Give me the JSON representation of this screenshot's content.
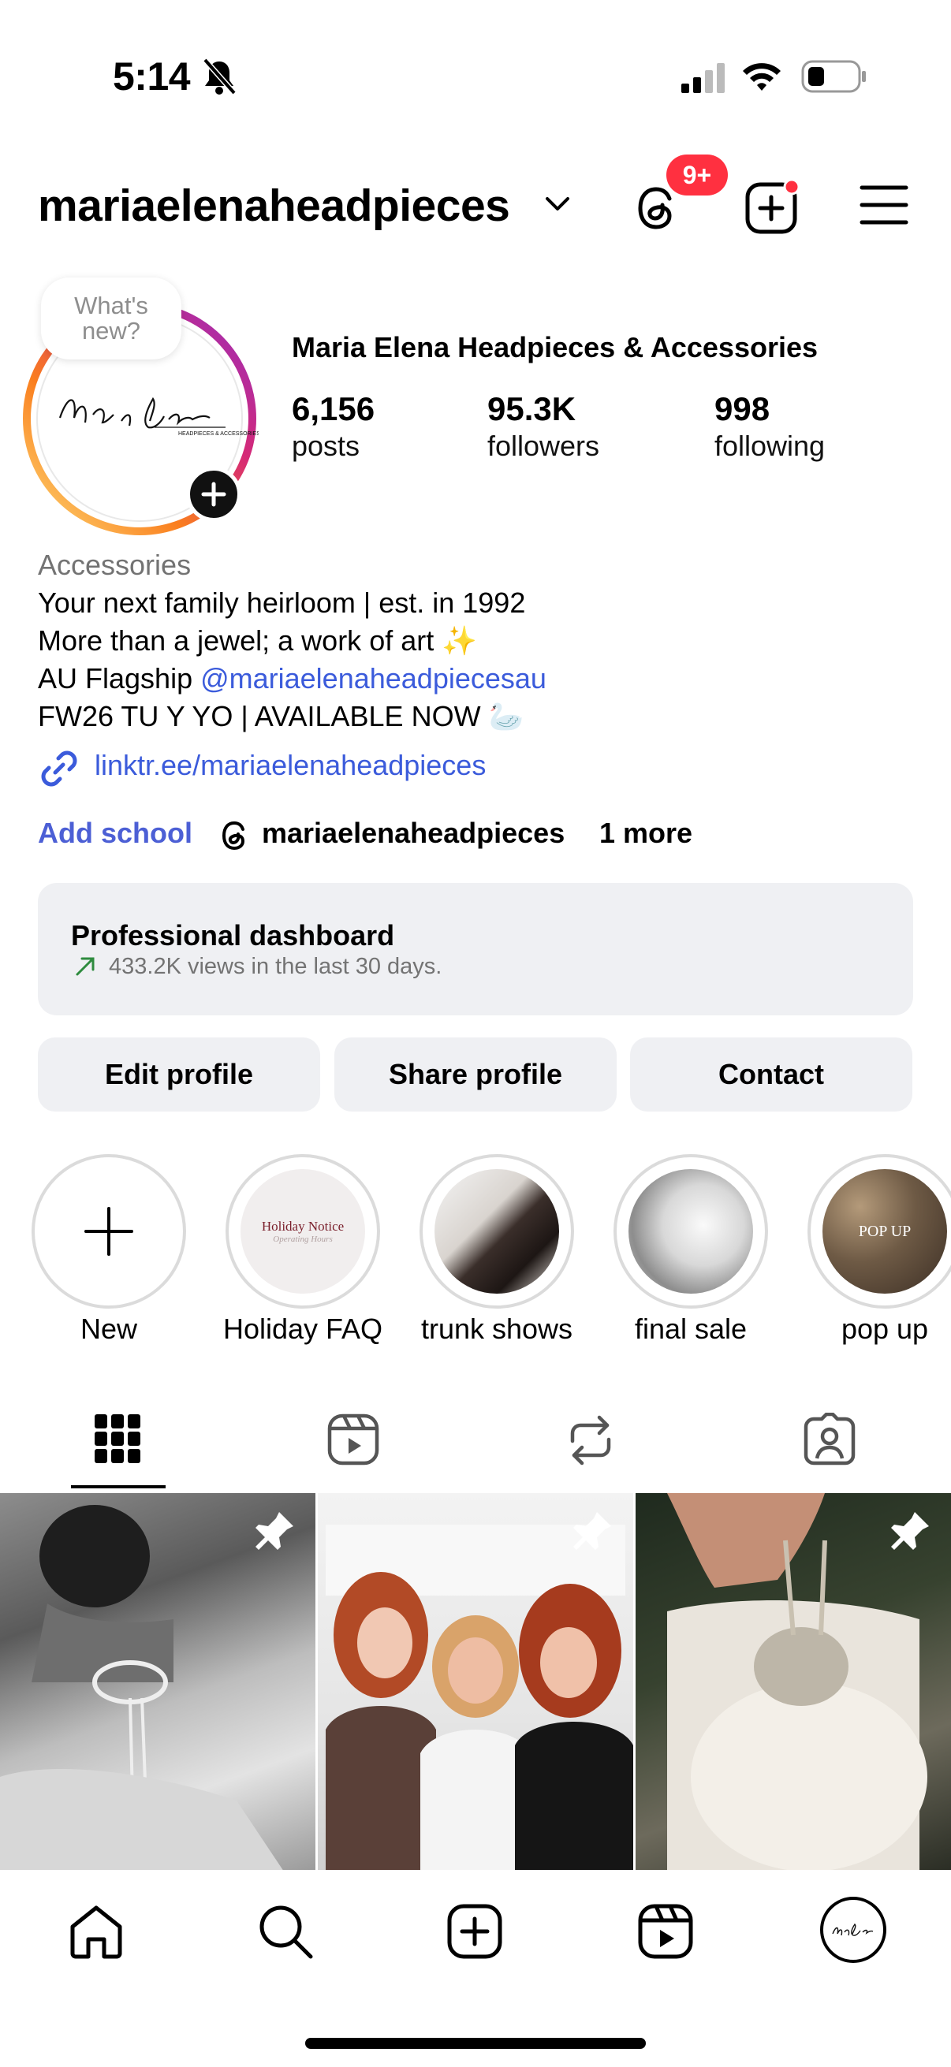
{
  "status_bar": {
    "time": "5:14"
  },
  "header": {
    "username": "mariaelenaheadpieces",
    "threads_badge": "9+"
  },
  "profile": {
    "story_bubble": "What's new?",
    "full_name": "Maria Elena Headpieces & Accessories",
    "stats": [
      {
        "value": "6,156",
        "label": "posts"
      },
      {
        "value": "95.3K",
        "label": "followers"
      },
      {
        "value": "998",
        "label": "following"
      }
    ],
    "category": "Accessories",
    "bio": {
      "line1": "Your next family heirloom | est. in 1992",
      "line2": "More than a jewel; a work of art ✨",
      "line3_prefix": "AU Flagship ",
      "line3_mention": "@mariaelenaheadpiecesau",
      "line4": "FW26 TU Y YO | AVAILABLE NOW 🦢"
    },
    "link": "linktr.ee/mariaelenaheadpieces",
    "add_school": "Add school",
    "threads_handle": "mariaelenaheadpieces",
    "more": "1 more"
  },
  "dashboard": {
    "title": "Professional dashboard",
    "subtitle": "433.2K views in the last 30 days."
  },
  "buttons": {
    "edit": "Edit profile",
    "share": "Share profile",
    "contact": "Contact"
  },
  "highlights": [
    {
      "label": "New"
    },
    {
      "label": "Holiday FAQ",
      "cover_title": "Holiday Notice",
      "cover_subtitle": "Operating Hours"
    },
    {
      "label": "trunk shows"
    },
    {
      "label": "final sale"
    },
    {
      "label": "pop up",
      "cover_title": "POP UP"
    }
  ],
  "tabs": [
    "grid-icon",
    "reels-icon",
    "reposts-icon",
    "tagged-icon"
  ],
  "grid": [
    {
      "caption": "black-and-white photo of woman's back wearing pearl necklace with bow",
      "pinned": true
    },
    {
      "caption": "three women smiling in a boutique",
      "pinned": true
    },
    {
      "caption": "woman holding embellished bag over feather dress",
      "pinned": true
    }
  ],
  "colors": {
    "accent_link": "#3b5bdb",
    "badge": "#ff3040",
    "button_bg": "#eff0f3"
  }
}
